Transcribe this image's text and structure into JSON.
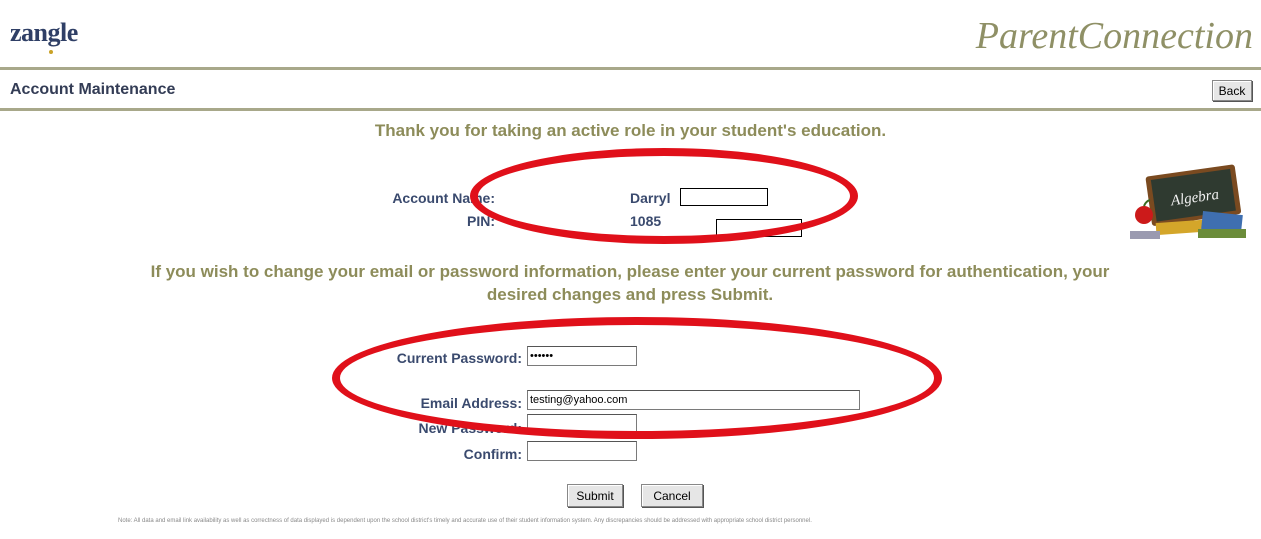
{
  "header": {
    "logo_text": "zangle",
    "brand_title": "ParentConnection"
  },
  "toolbar": {
    "section_title": "Account Maintenance",
    "back_label": "Back"
  },
  "main": {
    "thank_you": "Thank you for taking an active role in your student's education.",
    "account": {
      "name_label": "Account Name:",
      "name_value": "Darryl",
      "pin_label": "PIN:",
      "pin_value": "1085"
    },
    "instructions": "If you wish to change your email or password information, please enter your current password for authentication, your desired changes and press Submit.",
    "form": {
      "current_password_label": "Current Password:",
      "current_password_value": "••••••",
      "email_label": "Email Address:",
      "email_value": "testing@yahoo.com",
      "new_password_label": "New Password:",
      "new_password_value": "",
      "confirm_label": "Confirm:",
      "confirm_value": ""
    },
    "submit_label": "Submit",
    "cancel_label": "Cancel",
    "note": "Note: All data and email link availability as well as correctness of data displayed is dependent upon the school district's timely and accurate use of their student information system. Any discrepancies should be addressed with appropriate school district personnel."
  },
  "decor": {
    "chalkboard_text": "Algebra",
    "annotation_color": "#e0101a"
  }
}
